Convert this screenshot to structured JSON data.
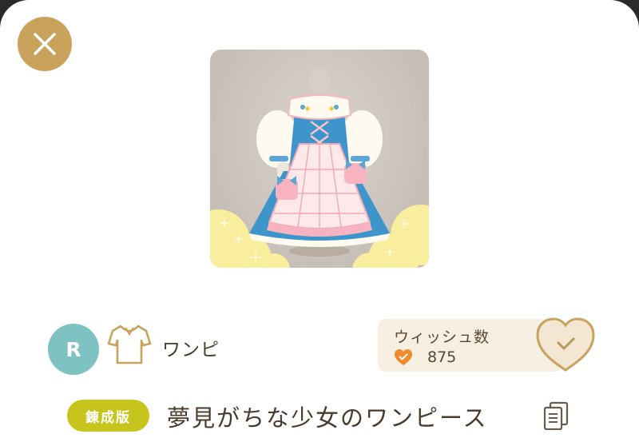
{
  "header": {
    "close_icon": "close-icon",
    "colors": {
      "close_bg": "#c9a35c"
    }
  },
  "item": {
    "image_icon": "one-piece-dress-illustration",
    "rarity": "R",
    "category_icon": "shirt-icon",
    "category": "ワンピ",
    "edition_label": "錬成版",
    "name": "夢見がちな少女のワンピース",
    "copy_icon": "copy-icon"
  },
  "wish": {
    "label": "ウィッシュ数",
    "count": "875",
    "heart_icon": "heart-check-icon",
    "button_icon": "heart-check-large-icon"
  },
  "colors": {
    "rarity_bg": "#7ec3c1",
    "edition_bg": "#c8c41e",
    "wish_panel_bg": "#f6efe2",
    "heart_orange": "#f08a2a",
    "text_brown": "#4a3a2a"
  }
}
